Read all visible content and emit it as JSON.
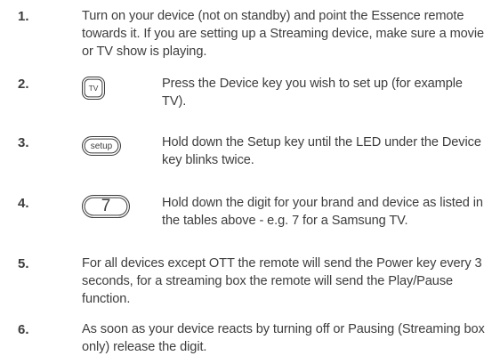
{
  "steps": [
    {
      "number": "1.",
      "text": "Turn on your device (not on standby) and point the Essence remote towards it. If you are setting up a Streaming device, make sure a movie or TV show is playing."
    },
    {
      "number": "2.",
      "key": "TV",
      "text": "Press the Device key you wish to set up (for example TV)."
    },
    {
      "number": "3.",
      "key": "setup",
      "text": "Hold down the Setup key until the LED under the Device key blinks twice."
    },
    {
      "number": "4.",
      "key": "7",
      "text": "Hold down the digit for your brand and device as listed in the tables above - e.g. 7  for a Samsung TV."
    },
    {
      "number": "5.",
      "text": "For all devices except OTT the remote will send the Power key every 3 seconds,  for a streaming box the remote will send the Play/Pause function."
    },
    {
      "number": "6.",
      "text": "As soon as your device reacts by turning off or Pausing (Streaming box only) release the digit."
    }
  ]
}
